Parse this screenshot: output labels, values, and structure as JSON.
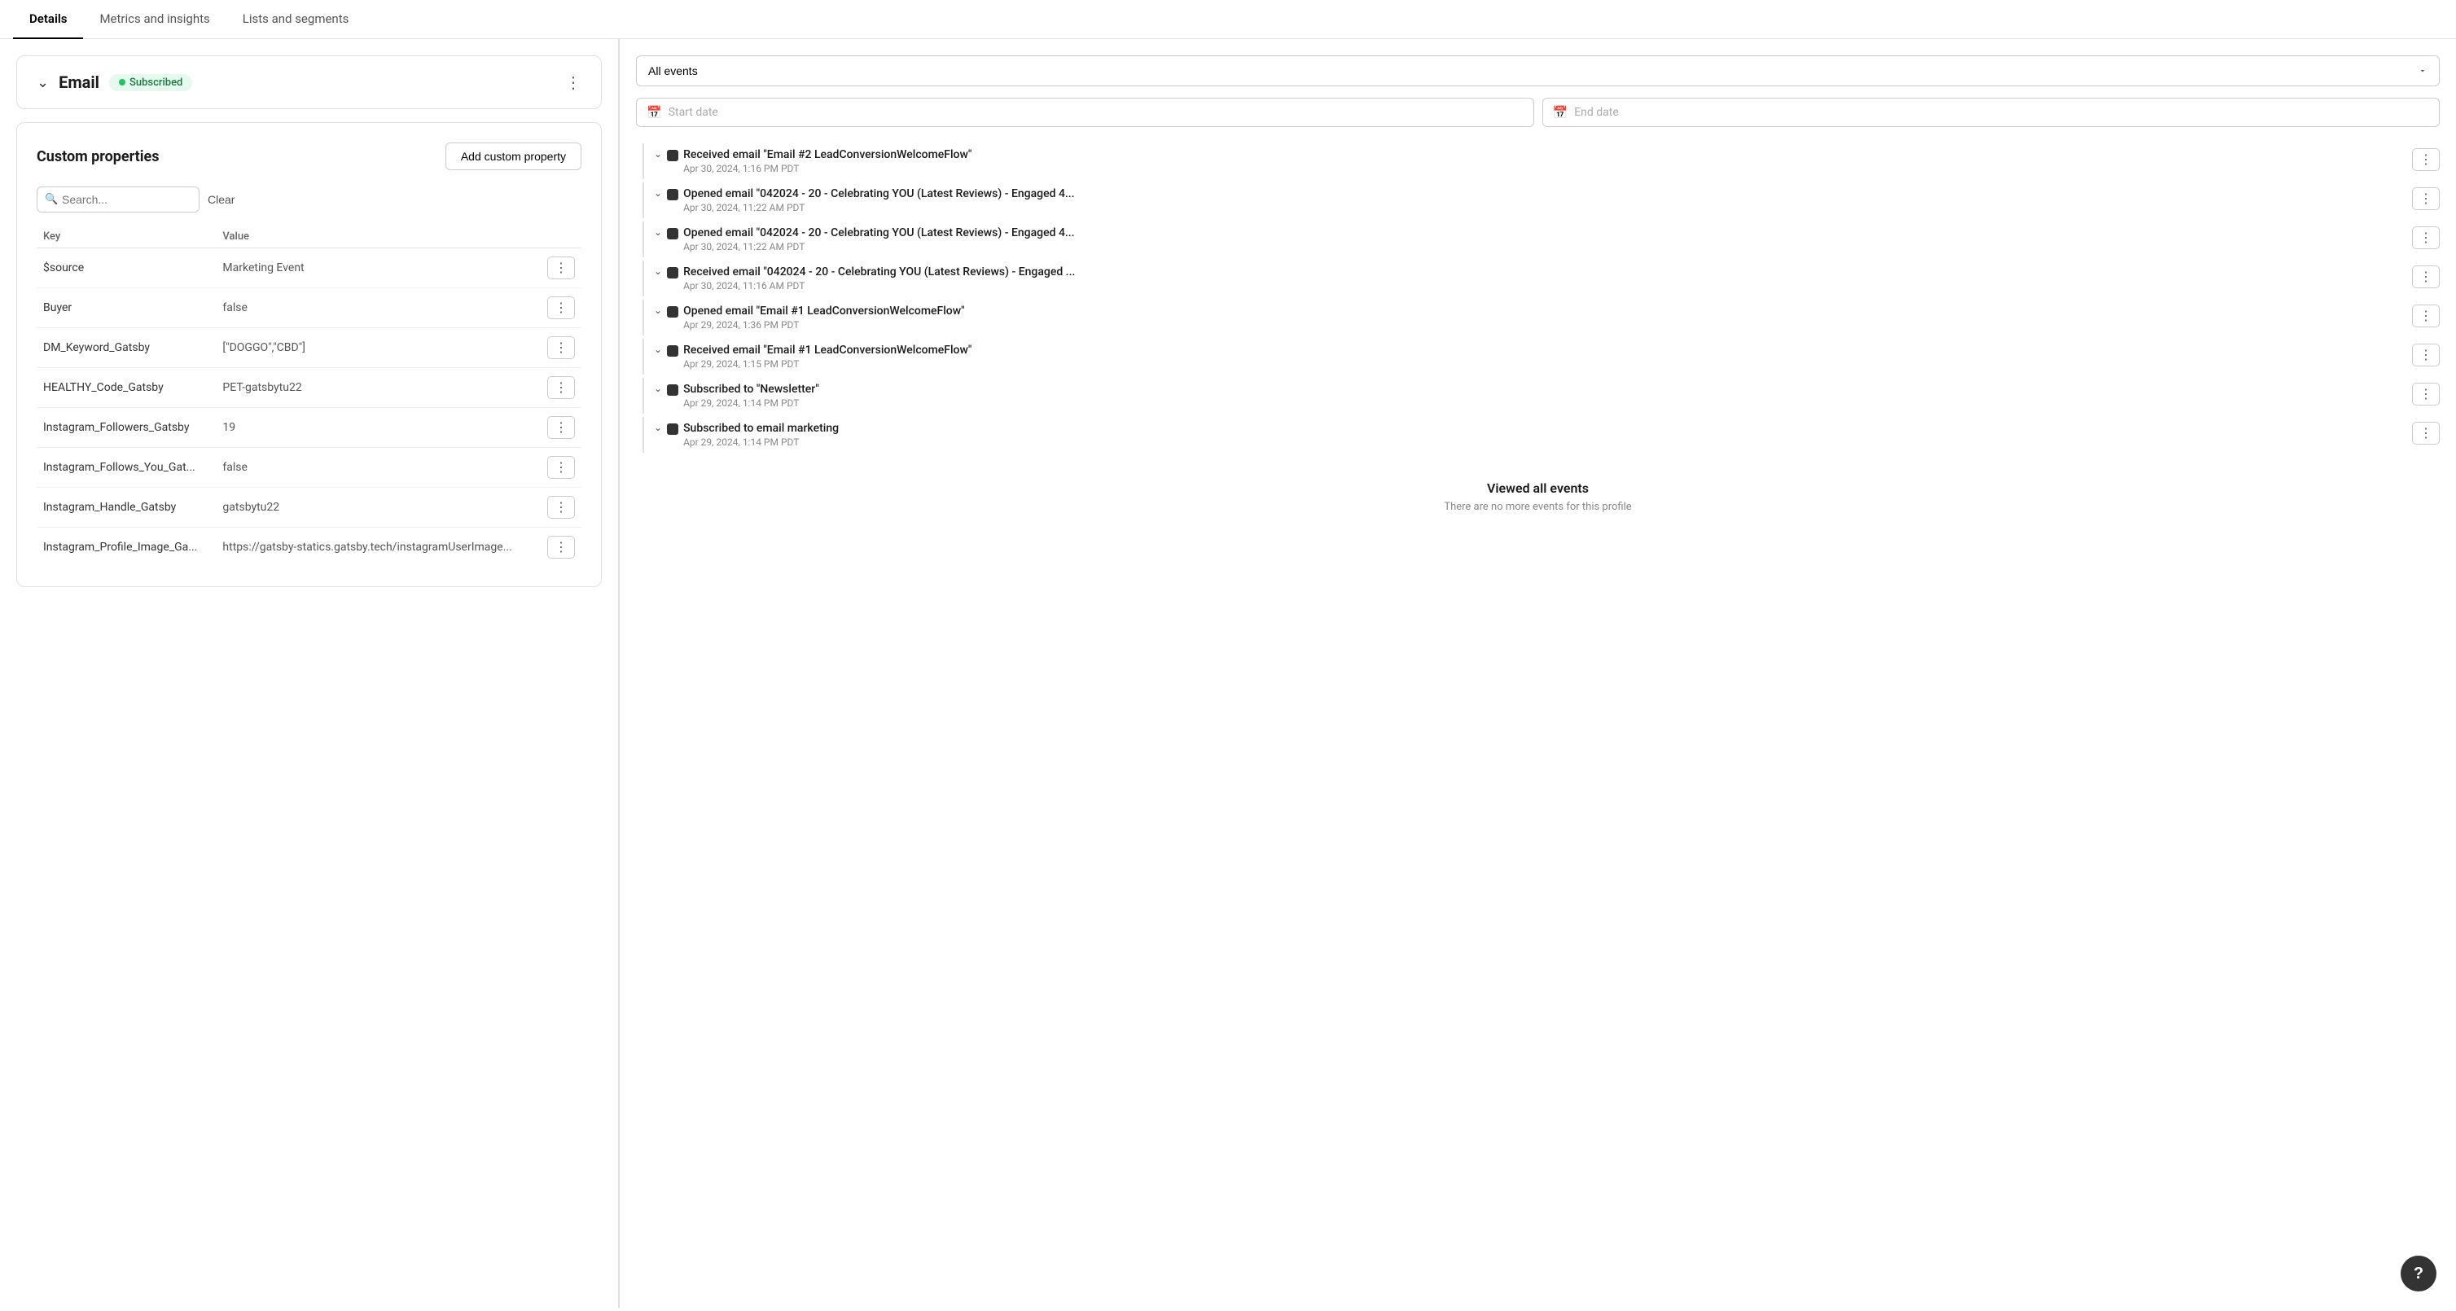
{
  "tabs": [
    {
      "label": "Details",
      "active": true
    },
    {
      "label": "Metrics and insights",
      "active": false
    },
    {
      "label": "Lists and segments",
      "active": false
    }
  ],
  "email_section": {
    "title": "Email",
    "status_label": "Subscribed",
    "more_icon": "⋮"
  },
  "custom_properties": {
    "title": "Custom properties",
    "add_button_label": "Add custom property",
    "search_placeholder": "Search...",
    "clear_label": "Clear",
    "columns": [
      {
        "label": "Key"
      },
      {
        "label": "Value"
      }
    ],
    "rows": [
      {
        "key": "$source",
        "value": "Marketing Event"
      },
      {
        "key": "Buyer",
        "value": "false"
      },
      {
        "key": "DM_Keyword_Gatsby",
        "value": "[\"DOGGO\",\"CBD\"]"
      },
      {
        "key": "HEALTHY_Code_Gatsby",
        "value": "PET-gatsbytu22"
      },
      {
        "key": "Instagram_Followers_Gatsby",
        "value": "19"
      },
      {
        "key": "Instagram_Follows_You_Gat...",
        "value": "false"
      },
      {
        "key": "Instagram_Handle_Gatsby",
        "value": "gatsbytu22"
      },
      {
        "key": "Instagram_Profile_Image_Ga...",
        "value": "https://gatsby-statics.gatsby.tech/instagramUserImage..."
      }
    ]
  },
  "events_filter": {
    "all_events_label": "All events",
    "start_date_placeholder": "Start date",
    "end_date_placeholder": "End date"
  },
  "events": [
    {
      "title": "Received email \"Email #2 LeadConversionWelcomeFlow\"",
      "date": "Apr 30, 2024, 1:16 PM PDT"
    },
    {
      "title": "Opened email \"042024 - 20 - Celebrating YOU (Latest Reviews) - Engaged 4...",
      "date": "Apr 30, 2024, 11:22 AM PDT"
    },
    {
      "title": "Opened email \"042024 - 20 - Celebrating YOU (Latest Reviews) - Engaged 4...",
      "date": "Apr 30, 2024, 11:22 AM PDT"
    },
    {
      "title": "Received email \"042024 - 20 - Celebrating YOU (Latest Reviews) - Engaged ...",
      "date": "Apr 30, 2024, 11:16 AM PDT"
    },
    {
      "title": "Opened email \"Email #1 LeadConversionWelcomeFlow\"",
      "date": "Apr 29, 2024, 1:36 PM PDT"
    },
    {
      "title": "Received email \"Email #1 LeadConversionWelcomeFlow\"",
      "date": "Apr 29, 2024, 1:15 PM PDT"
    },
    {
      "title": "Subscribed to \"Newsletter\"",
      "date": "Apr 29, 2024, 1:14 PM PDT"
    },
    {
      "title": "Subscribed to email marketing",
      "date": "Apr 29, 2024, 1:14 PM PDT"
    }
  ],
  "viewed_all": {
    "title": "Viewed all events",
    "subtitle": "There are no more events for this profile"
  },
  "help_label": "?"
}
